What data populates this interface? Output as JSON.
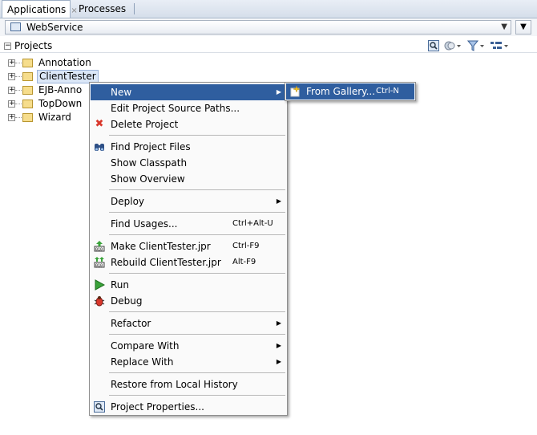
{
  "tabs": [
    {
      "label": "Applications",
      "close": "×"
    },
    {
      "label": "Processes"
    }
  ],
  "app_selector": {
    "value": "WebService"
  },
  "projects_header": {
    "label": "Projects"
  },
  "tree": [
    {
      "label": "Annotation"
    },
    {
      "label": "ClientTester"
    },
    {
      "label": "EJB-Anno"
    },
    {
      "label": "TopDown"
    },
    {
      "label": "Wizard"
    }
  ],
  "tree_expand_symbol": "+",
  "menu": {
    "new": "New",
    "edit_paths": "Edit Project Source Paths...",
    "delete": "Delete Project",
    "find_files": "Find Project Files",
    "show_classpath": "Show Classpath",
    "show_overview": "Show Overview",
    "deploy": "Deploy",
    "find_usages": "Find Usages...",
    "find_usages_acc": "Ctrl+Alt-U",
    "make": "Make ClientTester.jpr",
    "make_acc": "Ctrl-F9",
    "rebuild": "Rebuild ClientTester.jpr",
    "rebuild_acc": "Alt-F9",
    "run": "Run",
    "debug": "Debug",
    "refactor": "Refactor",
    "compare_with": "Compare With",
    "replace_with": "Replace With",
    "restore": "Restore from Local History",
    "properties": "Project Properties..."
  },
  "submenu": {
    "from_gallery": "From Gallery...",
    "from_gallery_acc": "Ctrl-N"
  },
  "colors": {
    "highlight": "#2f5e9f",
    "delete_icon": "#d9382c",
    "run_icon": "#3aa33a"
  }
}
